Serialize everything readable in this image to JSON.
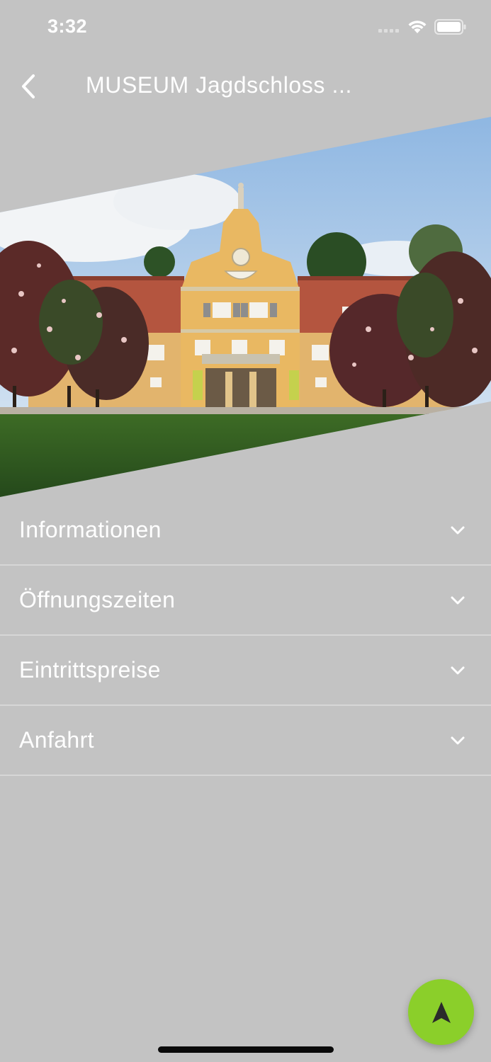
{
  "status_bar": {
    "time": "3:32"
  },
  "nav": {
    "title": "MUSEUM Jagdschloss ..."
  },
  "accordion": {
    "items": [
      {
        "label": "Informationen"
      },
      {
        "label": "Öffnungszeiten"
      },
      {
        "label": "Eintrittspreise"
      },
      {
        "label": "Anfahrt"
      }
    ]
  },
  "icons": {
    "back": "chevron-left-icon",
    "expand": "chevron-down-icon",
    "fab": "navigation-arrow-icon"
  },
  "colors": {
    "background": "#c3c3c3",
    "fab": "#8bcf2a",
    "divider": "#d6d6d6"
  }
}
